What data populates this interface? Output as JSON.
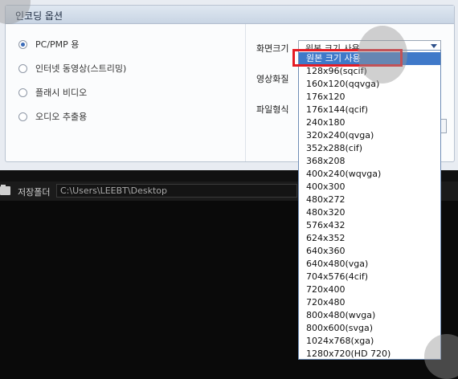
{
  "panel": {
    "title": "인코딩 옵션",
    "radios": [
      {
        "label": "PC/PMP 용",
        "checked": true
      },
      {
        "label": "인터넷 동영상(스트리밍)",
        "checked": false
      },
      {
        "label": "플래시 비디오",
        "checked": false
      },
      {
        "label": "오디오 추출용",
        "checked": false
      }
    ],
    "fields": {
      "screen_size_label": "화면크기",
      "video_quality_label": "영상화질",
      "file_format_label": "파일형식"
    },
    "screen_size_value": "원본 크기 사용"
  },
  "folder": {
    "label": "저장폴더",
    "path": "C:\\Users\\LEEBT\\Desktop"
  },
  "dropdown": {
    "selected_index": 0,
    "options": [
      "원본 크기 사용",
      "128x96(sqcif)",
      "160x120(qqvga)",
      "176x120",
      "176x144(qcif)",
      "240x180",
      "320x240(qvga)",
      "352x288(cif)",
      "368x208",
      "400x240(wqvga)",
      "400x300",
      "480x272",
      "480x320",
      "576x432",
      "624x352",
      "640x360",
      "640x480(vga)",
      "704x576(4cif)",
      "720x400",
      "720x480",
      "800x480(wvga)",
      "800x600(svga)",
      "1024x768(xga)",
      "1280x720(HD 720)"
    ]
  },
  "colors": {
    "highlight_border": "#e51b24",
    "selected_option_bg": "#3f79c9"
  }
}
